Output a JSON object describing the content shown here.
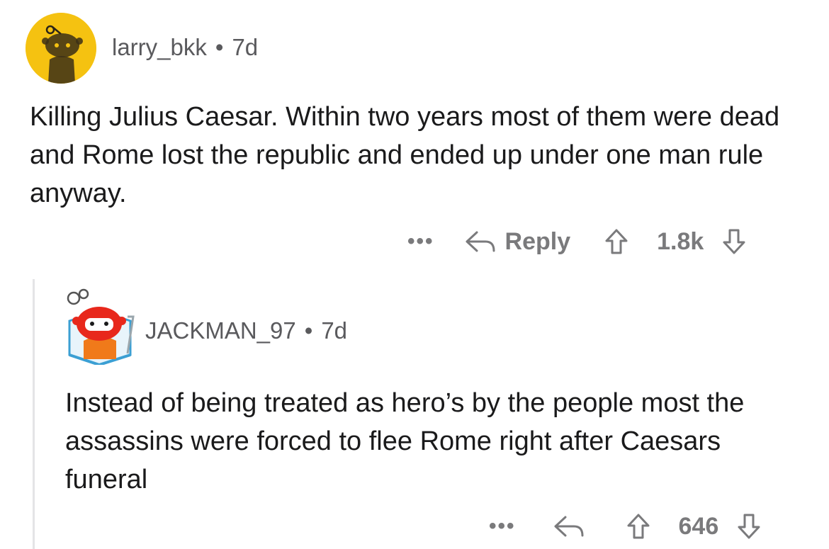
{
  "comment": {
    "username": "larry_bkk",
    "separator": "•",
    "age": "7d",
    "avatar_icon": "snoo-avatar-icon",
    "avatar_color": "#f5c211",
    "text": "Killing Julius Caesar. Within two years most of them were dead and Rome lost the republic and ended up under one man rule anyway.",
    "actions": {
      "more_label": "•••",
      "reply_label": "Reply",
      "vote_count": "1.8k"
    }
  },
  "reply": {
    "username": "JACKMAN_97",
    "separator": "•",
    "age": "7d",
    "avatar_icon": "robot-snoo-avatar-icon",
    "text": "Instead of being treated as hero’s by the people most the assassins were forced to flee Rome right after Caesars funeral",
    "actions": {
      "more_label": "•••",
      "vote_count": "646"
    }
  },
  "colors": {
    "text": "#1a1a1b",
    "meta": "#5a5a5d",
    "action": "#7a7a7c",
    "thread_line": "#e4e4e6"
  }
}
